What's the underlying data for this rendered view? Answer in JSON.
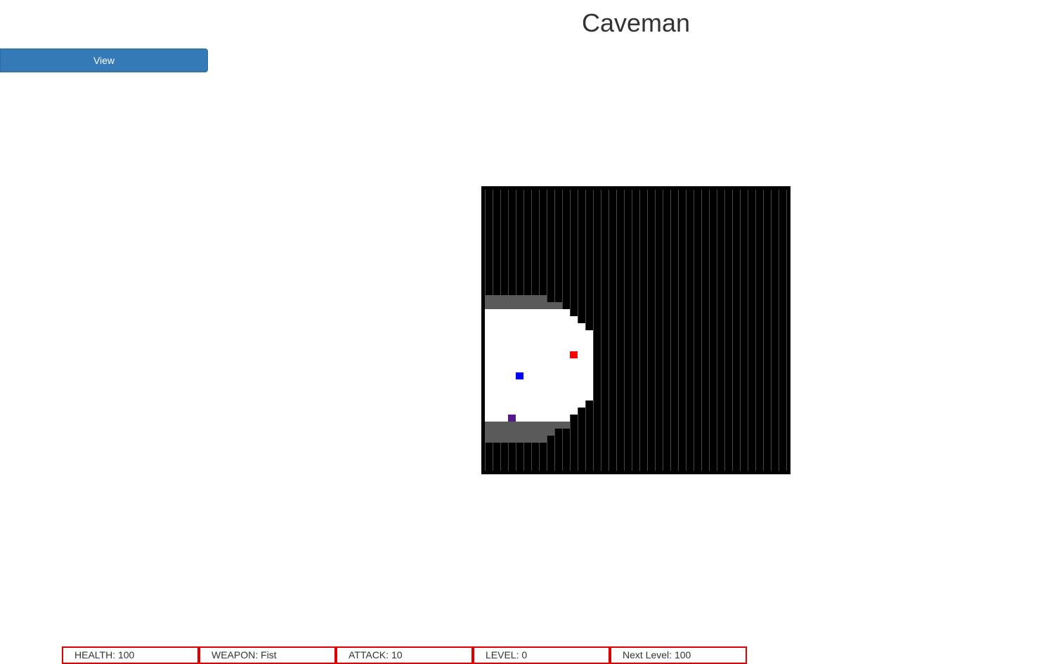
{
  "title": "Caveman",
  "view_button": {
    "label": "View"
  },
  "stats": [
    {
      "key": "health",
      "label": "HEALTH:",
      "value": "100"
    },
    {
      "key": "weapon",
      "label": "WEAPON:",
      "value": "Fist"
    },
    {
      "key": "attack",
      "label": "ATTACK:",
      "value": "10"
    },
    {
      "key": "level",
      "label": "LEVEL:",
      "value": "0"
    },
    {
      "key": "next_level",
      "label": "Next Level:",
      "value": "100"
    }
  ],
  "colors": {
    "wall": "#000000",
    "grid_line": "#777777",
    "explored_floor": "#5a5a5a",
    "floor": "#ffffff",
    "enemy": "#ff0000",
    "player": "#0000ff",
    "item": "#551a8b",
    "stat_border": "#e00000",
    "button": "#337ab7"
  },
  "game_map": {
    "columns": 40,
    "rows": 40,
    "entities": [
      {
        "type": "enemy",
        "color_key": "enemy",
        "col": 11,
        "row": 23
      },
      {
        "type": "player",
        "color_key": "player",
        "col": 4,
        "row": 26
      },
      {
        "type": "item",
        "color_key": "item",
        "col": 3,
        "row": 32
      }
    ]
  }
}
